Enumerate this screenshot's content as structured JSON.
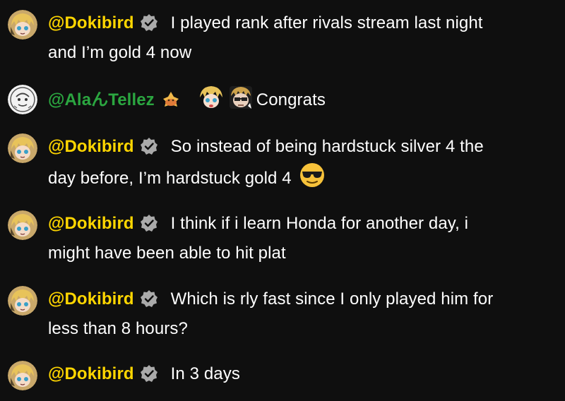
{
  "messages": [
    {
      "author": "@Dokibird",
      "author_color": "#ffd600",
      "badge": "verified-badge-icon",
      "text": "I played rank after rivals stream last night and I’m gold 4 now"
    },
    {
      "author": "@Alaんtellez",
      "author_display": "@AlaんTellez",
      "author_color": "#2ba640",
      "badge": "member-badge-icon",
      "emotes": [
        "dokibird-emote-icon",
        "dokibird-emote-2-icon"
      ],
      "text": "Congrats"
    },
    {
      "author": "@Dokibird",
      "author_color": "#ffd600",
      "badge": "verified-badge-icon",
      "text": "So instead of being hardstuck silver 4 the day before, I’m hardstuck gold 4",
      "trailing_emoji": "sunglasses-emoji-icon"
    },
    {
      "author": "@Dokibird",
      "author_color": "#ffd600",
      "badge": "verified-badge-icon",
      "text": "I think if i learn Honda for another day, i might have been able to hit plat"
    },
    {
      "author": "@Dokibird",
      "author_color": "#ffd600",
      "badge": "verified-badge-icon",
      "text": "Which is rly fast since I only played him for less than 8 hours?"
    },
    {
      "author": "@Dokibird",
      "author_color": "#ffd600",
      "badge": "verified-badge-icon",
      "text": "In 3 days"
    }
  ],
  "colors": {
    "background": "#0f0f0f",
    "owner_name": "#ffd600",
    "member_name": "#2ba640",
    "text": "#ffffff"
  }
}
